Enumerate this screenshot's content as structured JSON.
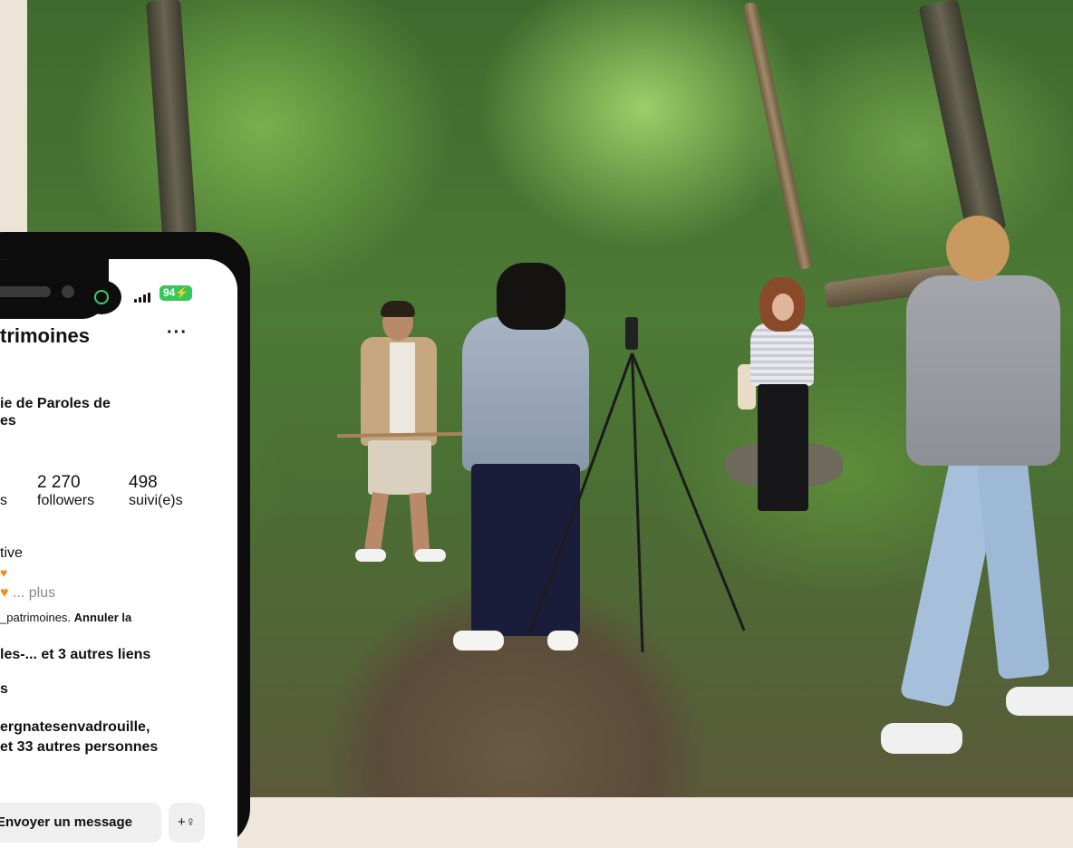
{
  "status_bar": {
    "battery": "94",
    "signal": "signal-bars-icon",
    "app_indicator": "green-ring-icon"
  },
  "profile": {
    "title": "trimoines",
    "more_label": "···",
    "subtitle_line1": "ie de Paroles de",
    "subtitle_line2": "es",
    "stats": [
      {
        "count": "",
        "label": "s"
      },
      {
        "count": "2 270",
        "label": "followers"
      },
      {
        "count": "498",
        "label": "suivi(e)s"
      }
    ],
    "category": "tive",
    "bio_line2_more": "... plus",
    "mention_prefix": "_patrimoines.",
    "mention_action": "Annuler la",
    "links_text": "les-...  et 3 autres liens",
    "s_line": "s",
    "followed_by_line1": "ergnatesenvadrouille,",
    "followed_by_line2": "et 33 autres personnes",
    "message_button": "Envoyer un message",
    "add_person_icon": "+♀"
  },
  "colors": {
    "background": "#efe6dc",
    "battery": "#35c75a",
    "heart": "#f08a24",
    "button_bg": "#efefef"
  },
  "photo": {
    "scene": "forest-filming-scene"
  }
}
